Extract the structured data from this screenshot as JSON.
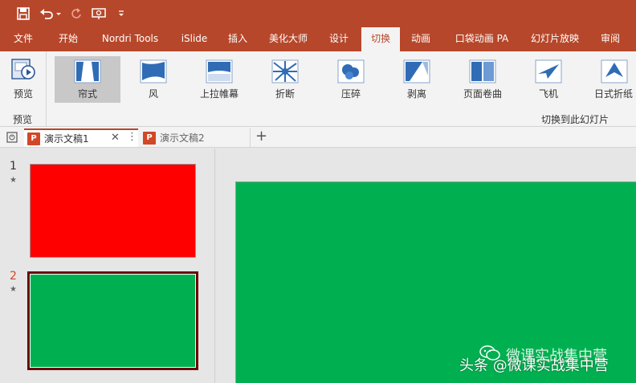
{
  "colors": {
    "accent": "#b7472a",
    "slide1_fill": "#ff0000",
    "slide2_fill": "#00b050",
    "thumb_selected_border": "#6b0000"
  },
  "quick_access": {
    "save_icon": "save-icon",
    "undo_icon": "undo-icon",
    "redo_icon": "redo-icon",
    "present_icon": "present-from-start-icon",
    "customize_icon": "customize-qat-icon"
  },
  "menu_tabs": [
    "文件",
    "开始",
    "Nordri Tools",
    "iSlide",
    "插入",
    "美化大师",
    "设计",
    "切换",
    "动画",
    "口袋动画 PA",
    "幻灯片放映",
    "审阅"
  ],
  "active_tab": "切换",
  "ribbon": {
    "preview_label": "预览",
    "preview_group_label": "预览",
    "transitions_group_label": "切换到此幻灯片",
    "transitions": [
      "帘式",
      "风",
      "上拉帷幕",
      "折断",
      "压碎",
      "剥离",
      "页面卷曲",
      "飞机",
      "日式折纸"
    ],
    "selected_transition": "帘式"
  },
  "doc_tabs": [
    {
      "label": "演示文稿1",
      "active": true
    },
    {
      "label": "演示文稿2",
      "active": false
    }
  ],
  "slides": [
    {
      "number": "1",
      "marker": "★",
      "fill": "#ff0000"
    },
    {
      "number": "2",
      "marker": "★",
      "fill": "#00b050",
      "selected": true
    }
  ],
  "watermark": {
    "line1": "微课实战集中营",
    "line2": "头条 @微课实战集中营"
  }
}
